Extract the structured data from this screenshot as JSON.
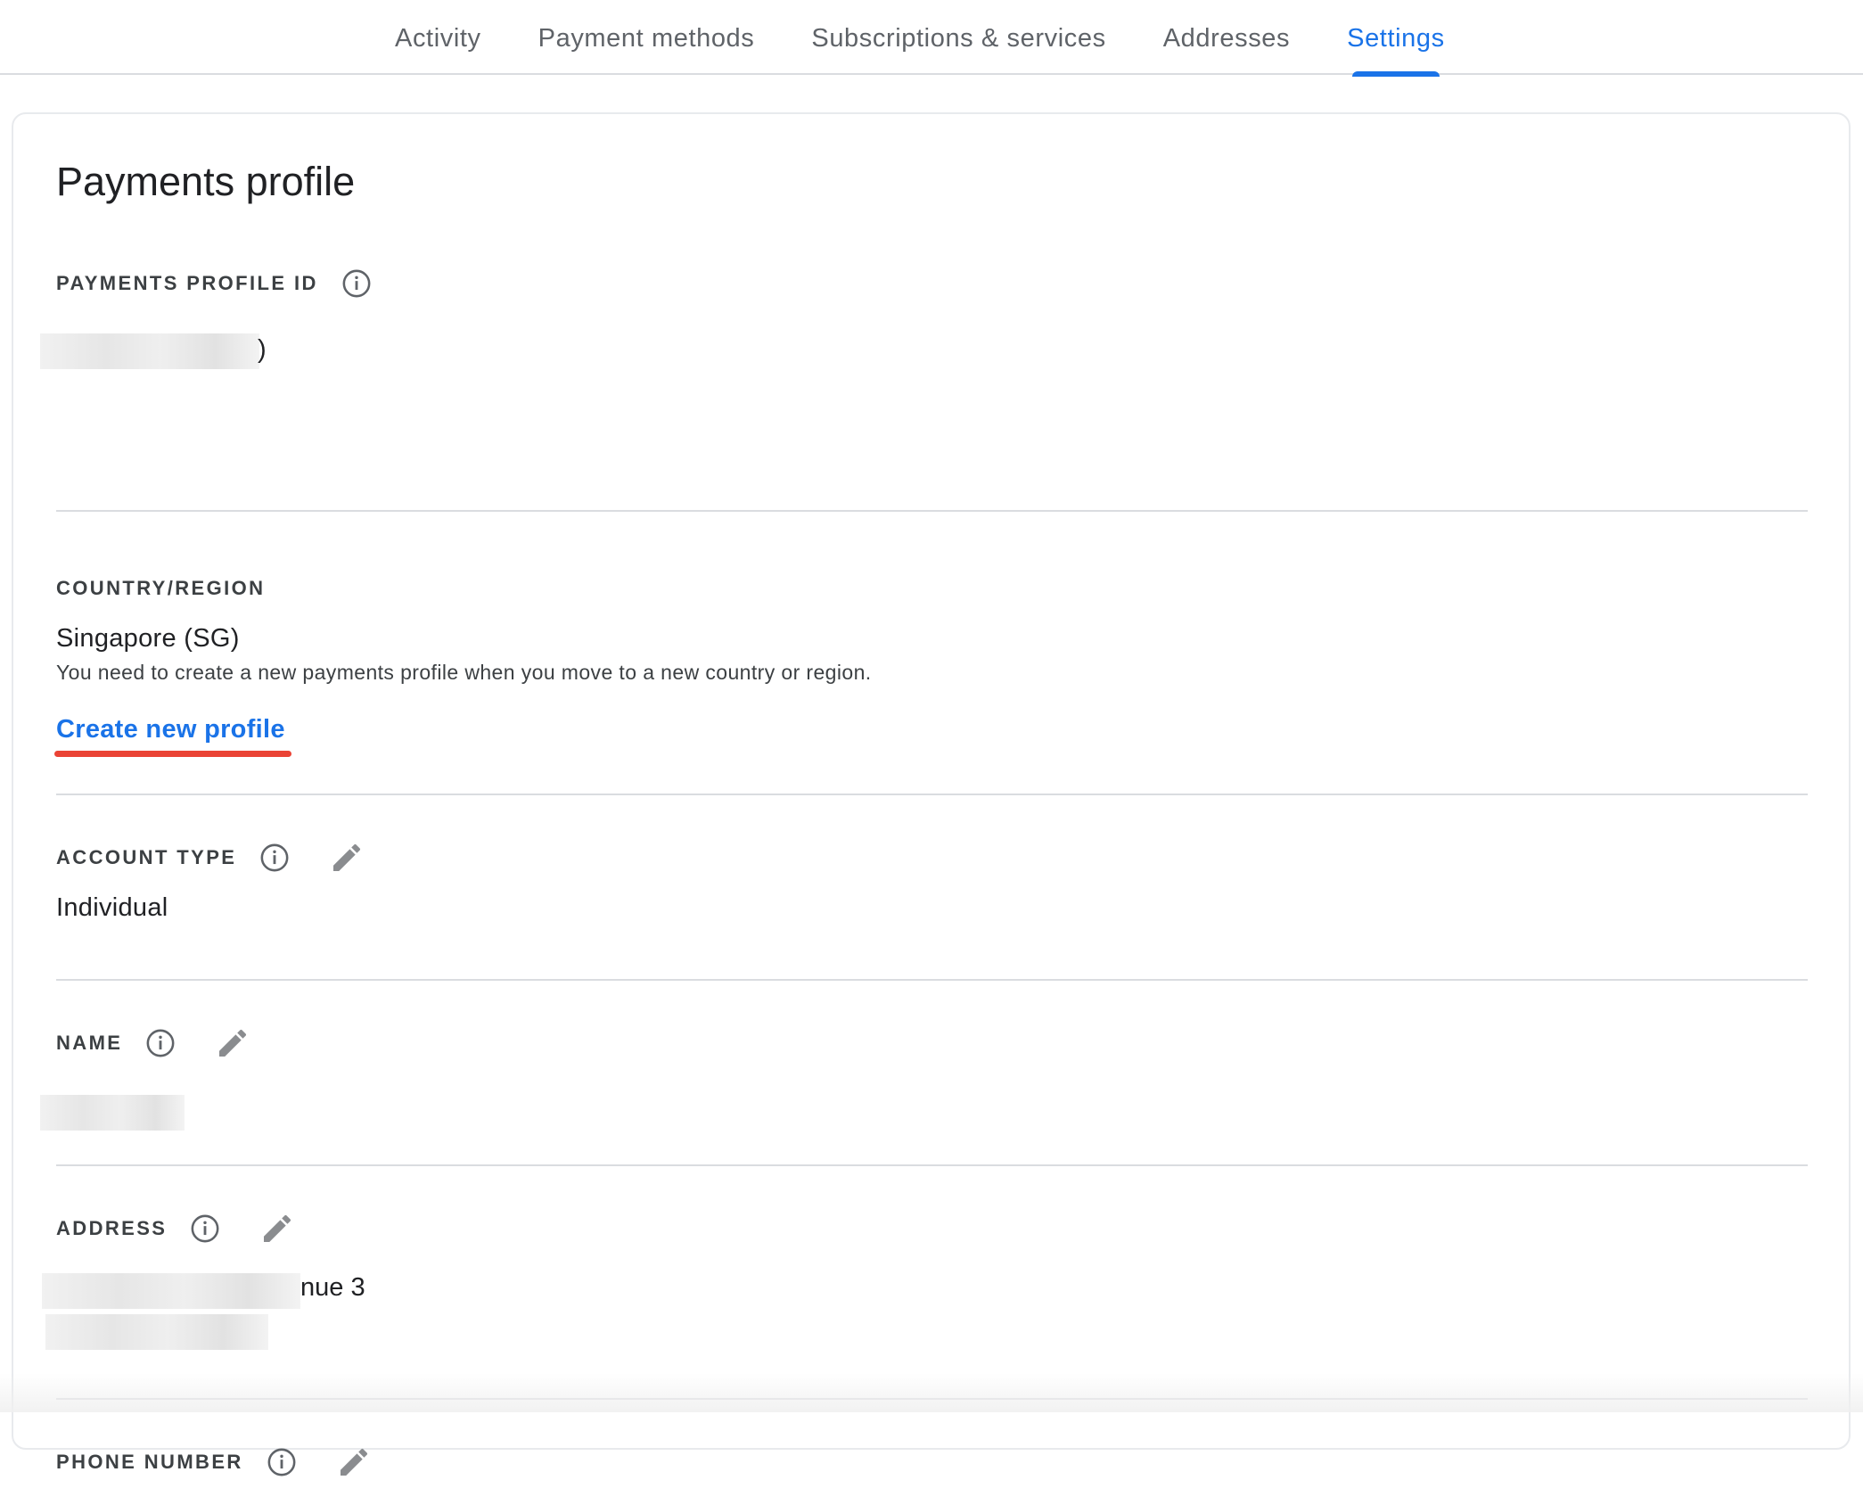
{
  "tabs": [
    {
      "label": "Activity"
    },
    {
      "label": "Payment methods"
    },
    {
      "label": "Subscriptions & services"
    },
    {
      "label": "Addresses"
    },
    {
      "label": "Settings",
      "active": true
    }
  ],
  "page_title": "Payments profile",
  "sections": {
    "profile_id": {
      "label": "PAYMENTS PROFILE ID",
      "visible_tail": ")"
    },
    "country": {
      "label": "COUNTRY/REGION",
      "value": "Singapore (SG)",
      "helper": "You need to create a new payments profile when you move to a new country or region.",
      "link": "Create new profile"
    },
    "account_type": {
      "label": "ACCOUNT TYPE",
      "value": "Individual"
    },
    "name": {
      "label": "NAME"
    },
    "address": {
      "label": "ADDRESS",
      "visible_tail": "nue 3"
    },
    "phone": {
      "label": "PHONE NUMBER"
    }
  },
  "icons": {
    "info": "info-circle-icon",
    "edit": "pencil-icon"
  },
  "colors": {
    "accent": "#1a73e8",
    "highlight": "#ea4335",
    "divider": "#dadce0"
  }
}
